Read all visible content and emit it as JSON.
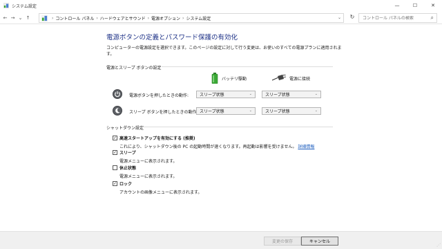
{
  "window": {
    "title": "システム設定",
    "minimize": "—",
    "maximize": "☐",
    "close": "✕"
  },
  "nav": {
    "back": "←",
    "forward": "→",
    "dropdown": "⌄",
    "up": "↑"
  },
  "breadcrumb": {
    "separator": "›",
    "items": [
      "コントロール パネル",
      "ハードウェアとサウンド",
      "電源オプション",
      "システム設定"
    ],
    "dropdown": "⌄"
  },
  "refresh": "↻",
  "search": {
    "placeholder": "コントロール パネルの検索",
    "icon": "⌕"
  },
  "main": {
    "heading": "電源ボタンの定義とパスワード保護の有効化",
    "description": "コンピューターの電源設定を選択できます。このページの設定に対して行う変更は、お使いのすべての電源プランに適用されます。",
    "power_section": {
      "label": "電源とスリープ ボタンの設定",
      "battery_label": "バッテリ駆動",
      "plugged_label": "電源に接続",
      "rows": [
        {
          "label": "電源ボタンを押したときの動作:",
          "battery": "スリープ状態",
          "plugged": "スリープ状態",
          "icon": "power-icon"
        },
        {
          "label": "スリープ ボタンを押したときの動作:",
          "battery": "スリープ状態",
          "plugged": "スリープ状態",
          "icon": "sleep-icon"
        }
      ]
    },
    "shutdown_section": {
      "label": "シャットダウン設定",
      "options": [
        {
          "title": "高速スタートアップを有効にする (推奨)",
          "desc": "これにより、シャットダウン後の PC の起動時間が速くなります。再起動は影響を受けません。",
          "link": "詳細情報",
          "checked": true
        },
        {
          "title": "スリープ",
          "desc": "電源メニューに表示されます。",
          "checked": true
        },
        {
          "title": "休止状態",
          "desc": "電源メニューに表示されます。",
          "checked": false
        },
        {
          "title": "ロック",
          "desc": "アカウントの画像メニューに表示されます。",
          "checked": true
        }
      ]
    }
  },
  "footer": {
    "save": "変更の保存",
    "cancel": "キャンセル"
  },
  "colors": {
    "heading": "#1e3287",
    "link": "#1f5fbf",
    "battery_green": "#3aa935"
  }
}
